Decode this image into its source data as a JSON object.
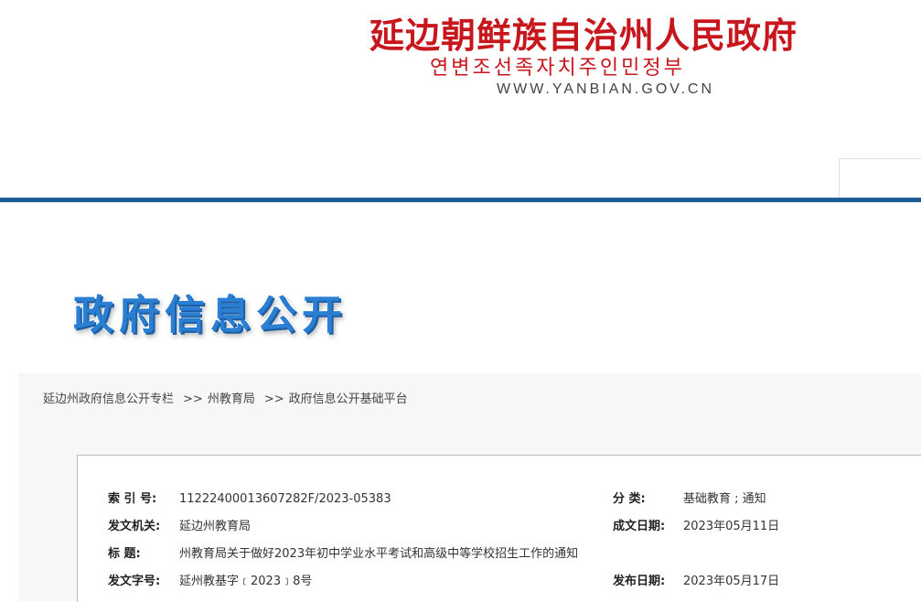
{
  "header": {
    "title_cn": "延边朝鲜族自治州人民政府",
    "title_kr": "연변조선족자치주인민정부",
    "url": "WWW.YANBIAN.GOV.CN"
  },
  "banner": {
    "title": "政府信息公开"
  },
  "breadcrumb": {
    "items": [
      "延边州政府信息公开专栏",
      "州教育局",
      "政府信息公开基础平台"
    ],
    "separator": ">>"
  },
  "info": {
    "index_label": "索 引 号:",
    "index_value": "11222400013607282F/2023-05383",
    "category_label": "分 类:",
    "category_value": "基础教育 ; 通知",
    "issuer_label": "发文机关:",
    "issuer_value": "延边州教育局",
    "created_label": "成文日期:",
    "created_value": "2023年05月11日",
    "title_label": "标 题:",
    "title_value": "州教育局关于做好2023年初中学业水平考试和高级中等学校招生工作的通知",
    "docno_label": "发文字号:",
    "docno_value": "延州教基字﹝2023﹞8号",
    "published_label": "发布日期:",
    "published_value": "2023年05月17日"
  },
  "colors": {
    "brand_red": "#c8161d",
    "nav_blue": "#1f5d99",
    "banner_blue": "#2a7fd2"
  }
}
